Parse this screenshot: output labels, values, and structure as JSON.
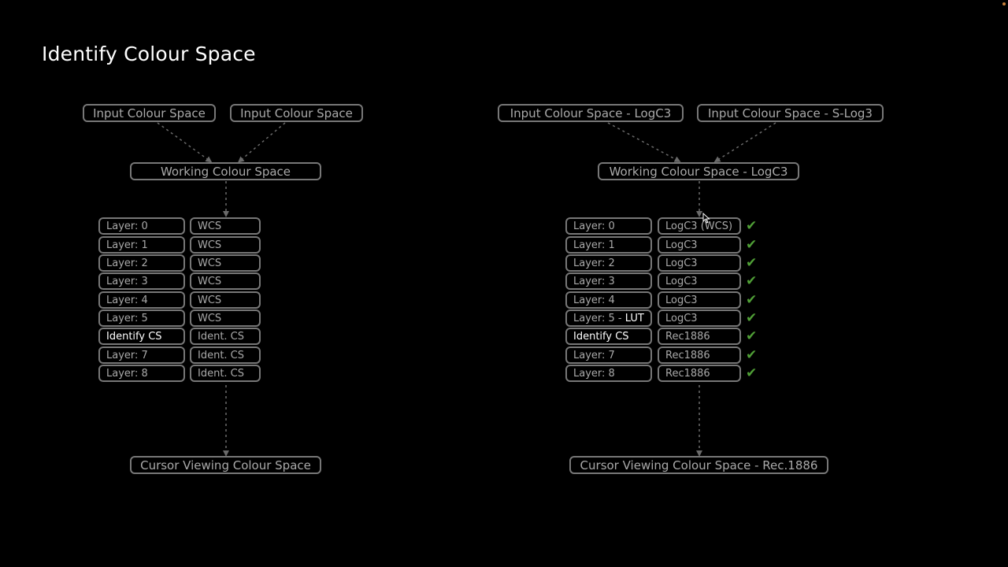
{
  "title": "Identify Colour Space",
  "left": {
    "inputs": [
      "Input Colour Space",
      "Input Colour Space"
    ],
    "working": "Working Colour Space",
    "layers": [
      "Layer: 0",
      "Layer: 1",
      "Layer: 2",
      "Layer: 3",
      "Layer: 4",
      "Layer: 5",
      "Identify CS",
      "Layer: 7",
      "Layer: 8"
    ],
    "spaces": [
      "WCS",
      "WCS",
      "WCS",
      "WCS",
      "WCS",
      "WCS",
      "Ident. CS",
      "Ident. CS",
      "Ident. CS"
    ],
    "viewing": "Cursor Viewing Colour Space"
  },
  "right": {
    "inputs": [
      "Input Colour Space - LogC3",
      "Input Colour Space - S-Log3"
    ],
    "working": "Working Colour Space - LogC3",
    "layers": [
      "Layer: 0",
      "Layer: 1",
      "Layer: 2",
      "Layer: 3",
      "Layer: 4",
      "Layer: 5 - ",
      "Identify CS",
      "Layer: 7",
      "Layer: 8"
    ],
    "layer5_suffix": "LUT",
    "spaces": [
      "LogC3 (WCS)",
      "LogC3",
      "LogC3",
      "LogC3",
      "LogC3",
      "LogC3",
      "Rec1886",
      "Rec1886",
      "Rec1886"
    ],
    "check_mark": "✔",
    "viewing": "Cursor Viewing Colour Space - Rec.1886"
  },
  "colors": {
    "background": "#000000",
    "box_border": "#777777",
    "text": "#a9a9a9",
    "highlight_text": "#ffffff",
    "check": "#4f9e36",
    "connector": "#6a6a6a"
  }
}
